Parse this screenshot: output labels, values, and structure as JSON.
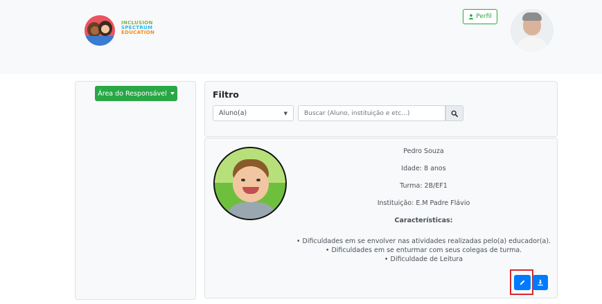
{
  "header": {
    "logo": {
      "line1": "INCLUSION",
      "line2": "SPECTRUM",
      "line3": "EDUCATION"
    },
    "perfil_button": "Perfil",
    "icons": {
      "user": "user-icon",
      "avatar": "profile-avatar"
    }
  },
  "sidebar": {
    "area_button": "Área do Responsável"
  },
  "filter": {
    "title": "Filtro",
    "select_value": "Aluno(a)",
    "search_placeholder": "Buscar (Aluno, instituição e etc...)",
    "search_icon": "search-icon"
  },
  "student": {
    "name": "Pedro Souza",
    "age": "Idade: 8 anos",
    "class": "Turma: 2B/EF1",
    "institution": "Instituição: E.M Padre Flávio",
    "characteristics_title": "Características:",
    "characteristics": [
      "• Dificuldades em se envolver nas atividades realizadas pelo(a) educador(a).",
      "• Dificuldades em se enturmar com seus colegas de turma.",
      "• Dificuldade de Leitura"
    ],
    "actions": {
      "edit_icon": "pencil-icon",
      "download_icon": "download-icon"
    }
  },
  "colors": {
    "green": "#28a745",
    "blue": "#007bff",
    "highlight": "#d9262c"
  }
}
